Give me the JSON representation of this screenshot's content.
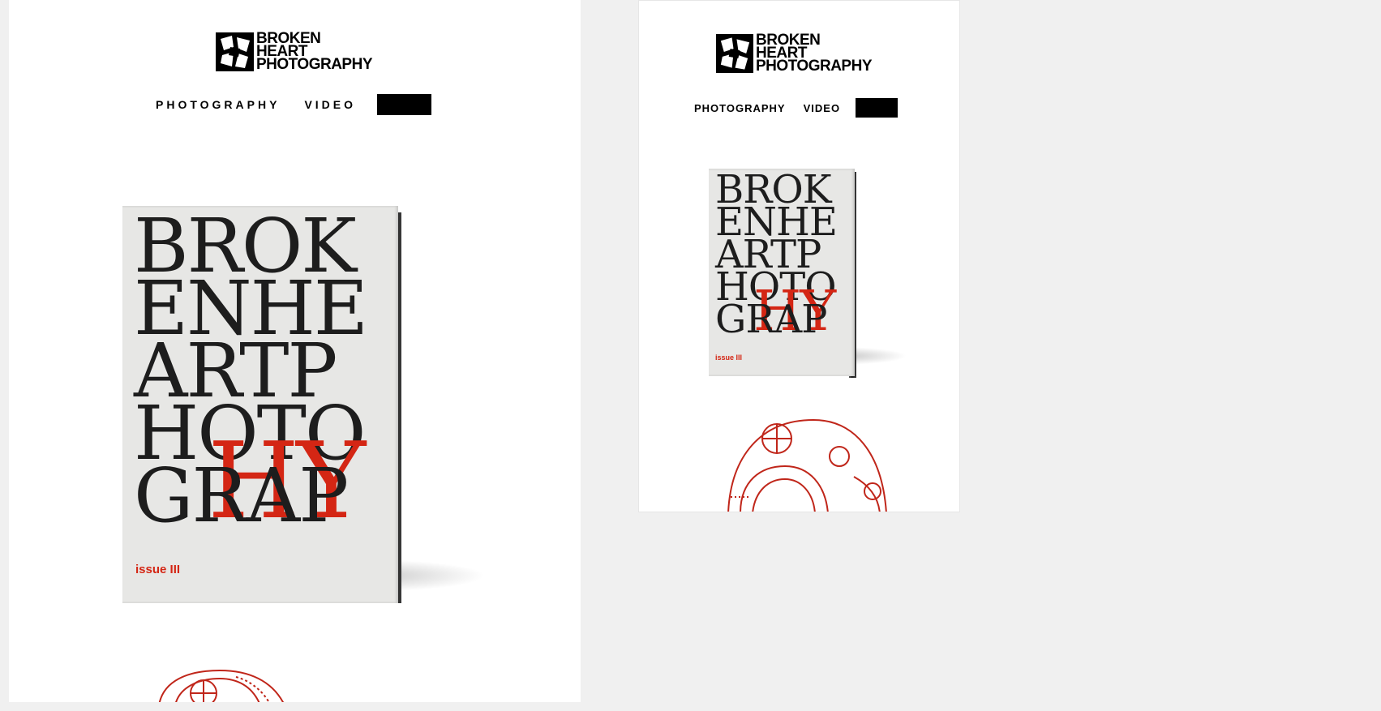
{
  "brand": {
    "line1": "BROKEN",
    "line2": "HEART",
    "line3": "PHOTOGRAPHY"
  },
  "nav": {
    "photography_label": "PHOTOGRAPHY",
    "video_label": "VIDEO"
  },
  "book": {
    "cover_lines": [
      "BROK",
      "ENHE",
      "ARTP",
      "HOTO",
      "GRAP"
    ],
    "overlay": "HY",
    "issue": "issue III"
  },
  "colors": {
    "background": "#f0f0f0",
    "panel": "#ffffff",
    "accent_red": "#d42614",
    "text": "#000000"
  },
  "icons": {
    "logo": "broken-heart-logo-icon",
    "helmet": "diving-helmet-illustration"
  }
}
